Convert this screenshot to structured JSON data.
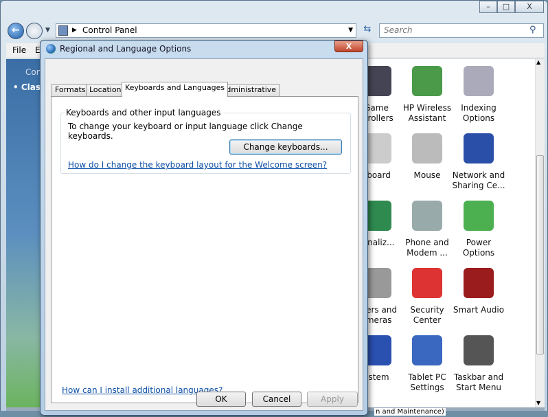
{
  "window": {
    "minimize": "–",
    "maximize": "□",
    "close": "X"
  },
  "address": {
    "path": "Control Panel"
  },
  "search": {
    "placeholder": "Search"
  },
  "menu": {
    "file": "File",
    "edit": "E"
  },
  "left_pane": {
    "heading": "Con",
    "item": "Clas"
  },
  "items": [
    {
      "label": "Game\nntrollers",
      "icon": "gamepad-icon",
      "color": "#445"
    },
    {
      "label": "HP Wireless\nAssistant",
      "icon": "wireless-icon",
      "color": "#4a9a4a"
    },
    {
      "label": "Indexing\nOptions",
      "icon": "indexing-icon",
      "color": "#aab"
    },
    {
      "label": "yboard",
      "icon": "keyboard-icon",
      "color": "#ccc"
    },
    {
      "label": "Mouse",
      "icon": "mouse-icon",
      "color": "#bbb"
    },
    {
      "label": "Network and\nSharing Ce...",
      "icon": "network-icon",
      "color": "#2a4fa8"
    },
    {
      "label": "sonaliz...",
      "icon": "personalization-icon",
      "color": "#2f8a50"
    },
    {
      "label": "Phone and\nModem ...",
      "icon": "phone-icon",
      "color": "#9aa"
    },
    {
      "label": "Power\nOptions",
      "icon": "power-icon",
      "color": "#4caf50"
    },
    {
      "label": "nners and\nameras",
      "icon": "scanner-icon",
      "color": "#999"
    },
    {
      "label": "Security\nCenter",
      "icon": "shield-icon",
      "color": "#d33"
    },
    {
      "label": "Smart Audio",
      "icon": "audio-icon",
      "color": "#9b1c1c"
    },
    {
      "label": "ystem",
      "icon": "system-icon",
      "color": "#2a50b0"
    },
    {
      "label": "Tablet PC\nSettings",
      "icon": "tablet-icon",
      "color": "#3a68c0"
    },
    {
      "label": "Taskbar and\nStart Menu",
      "icon": "taskbar-icon",
      "color": "#555"
    }
  ],
  "status": {
    "text": "n and Maintenance)"
  },
  "dialog": {
    "title": "Regional and Language Options",
    "close": "X",
    "tabs": [
      "Formats",
      "Location",
      "Keyboards and Languages",
      "Administrative"
    ],
    "active_tab": "Keyboards and Languages",
    "group_title": "Keyboards and other input languages",
    "group_desc": "To change your keyboard or input language click Change keyboards.",
    "change_button": "Change keyboards...",
    "welcome_link": "How do I change the keyboard layout for the Welcome screen?",
    "install_link": "How can I install additional languages?",
    "ok": "OK",
    "cancel": "Cancel",
    "apply": "Apply"
  }
}
